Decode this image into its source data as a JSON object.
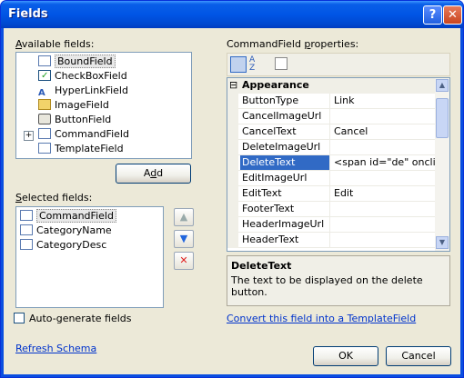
{
  "window": {
    "title": "Fields",
    "help_glyph": "?",
    "close_glyph": "✕"
  },
  "available": {
    "label": "Available fields:",
    "label_underline": "A",
    "label_rest": "vailable fields:",
    "items": [
      {
        "label": "BoundField",
        "icon": "boundfield-icon",
        "selected": true
      },
      {
        "label": "CheckBoxField",
        "icon": "checkbox-icon"
      },
      {
        "label": "HyperLinkField",
        "icon": "hyperlink-icon"
      },
      {
        "label": "ImageField",
        "icon": "image-icon"
      },
      {
        "label": "ButtonField",
        "icon": "button-icon"
      },
      {
        "label": "CommandField",
        "icon": "command-icon",
        "expandable": true,
        "expand_glyph": "+"
      },
      {
        "label": "TemplateField",
        "icon": "template-icon"
      }
    ]
  },
  "add_button": {
    "label_pre": "A",
    "label_ul": "d",
    "label_post": "d"
  },
  "selected": {
    "label_ul": "S",
    "label_rest": "elected fields:",
    "items": [
      {
        "label": "CommandField",
        "selected": true
      },
      {
        "label": "CategoryName"
      },
      {
        "label": "CategoryDesc"
      }
    ]
  },
  "move_up_glyph": "▲",
  "move_down_glyph": "▼",
  "delete_glyph": "✕",
  "autogen": {
    "label": "Auto-generate fields",
    "checked": false
  },
  "refresh_link": "Refresh Schema",
  "properties": {
    "label": "CommandField properties:",
    "label_ul": "p",
    "label_pre": "CommandField ",
    "label_post": "roperties:",
    "category_toggle": "⊟",
    "category": "Appearance",
    "rows": [
      {
        "name": "ButtonType",
        "value": "Link"
      },
      {
        "name": "CancelImageUrl",
        "value": ""
      },
      {
        "name": "CancelText",
        "value": "Cancel"
      },
      {
        "name": "DeleteImageUrl",
        "value": ""
      },
      {
        "name": "DeleteText",
        "value": "<span id=\"de\" oncli",
        "selected": true
      },
      {
        "name": "EditImageUrl",
        "value": ""
      },
      {
        "name": "EditText",
        "value": "Edit"
      },
      {
        "name": "FooterText",
        "value": ""
      },
      {
        "name": "HeaderImageUrl",
        "value": ""
      },
      {
        "name": "HeaderText",
        "value": ""
      }
    ]
  },
  "description": {
    "title": "DeleteText",
    "text": "The text to be displayed on the delete button."
  },
  "convert_link": "Convert this field into a TemplateField",
  "ok_button": "OK",
  "cancel_button": "Cancel"
}
